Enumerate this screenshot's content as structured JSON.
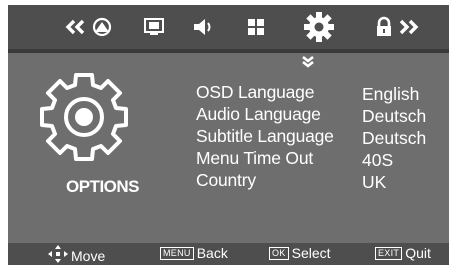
{
  "top_menu": {
    "items": [
      {
        "name": "left-arrows-icon"
      },
      {
        "name": "picture-icon"
      },
      {
        "name": "screen-icon"
      },
      {
        "name": "sound-icon"
      },
      {
        "name": "grid-icon"
      },
      {
        "name": "gear-icon",
        "selected": true
      },
      {
        "name": "lock-icon"
      },
      {
        "name": "right-arrows-icon"
      }
    ]
  },
  "page": {
    "title": "OPTIONS"
  },
  "menu": {
    "items": [
      {
        "label": "OSD Language",
        "value": "English"
      },
      {
        "label": "Audio Language",
        "value": "Deutsch"
      },
      {
        "label": "Subtitle Language",
        "value": "Deutsch"
      },
      {
        "label": "Menu Time Out",
        "value": "40S"
      },
      {
        "label": "Country",
        "value": "UK"
      }
    ]
  },
  "bottom_bar": {
    "move": "Move",
    "menu_key": "MENU",
    "back": "Back",
    "ok_key": "OK",
    "select": "Select",
    "exit_key": "EXIT",
    "quit": "Quit"
  },
  "colors": {
    "bar": "#4e4e4e",
    "panel": "#6e6e6e",
    "text": "#ffffff"
  }
}
